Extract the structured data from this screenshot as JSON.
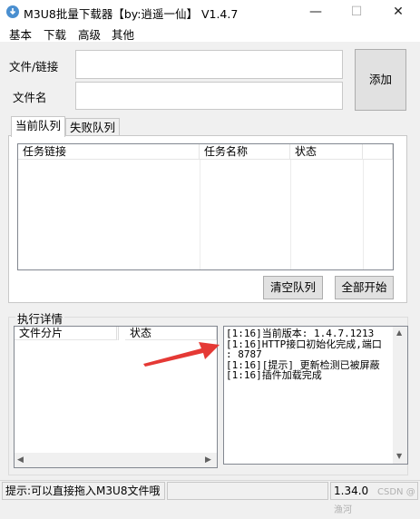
{
  "window": {
    "title": "M3U8批量下载器【by:逍遥一仙】 V1.4.7",
    "minimize": "—",
    "maximize": "☐",
    "close": "✕"
  },
  "menu": [
    "基本",
    "下载",
    "高级",
    "其他"
  ],
  "form": {
    "file_link_label": "文件/链接",
    "file_name_label": "文件名",
    "file_link_value": "",
    "file_name_value": "",
    "add_button": "添加"
  },
  "tabs": [
    "当前队列",
    "失败队列"
  ],
  "queue_table": {
    "columns": [
      "任务链接",
      "任务名称",
      "状态"
    ],
    "rows": []
  },
  "queue_buttons": {
    "clear": "清空队列",
    "start_all": "全部开始"
  },
  "details": {
    "group_title": "执行详情",
    "columns": [
      "文件分片",
      "状态"
    ],
    "log_lines": [
      "[1:16]当前版本: 1.4.7.1213",
      "[1:16]HTTP接口初始化完成,端口",
      ": 8787",
      "[1:16][提示] 更新检测已被屏蔽",
      "[1:16]插件加载完成"
    ]
  },
  "status": {
    "hint": "提示:可以直接拖入M3U8文件哦",
    "version": "1.34.0",
    "watermark": "CSDN @渔河"
  },
  "colors": {
    "arrow": "#e53935",
    "app_icon": "#4a8fd0"
  }
}
